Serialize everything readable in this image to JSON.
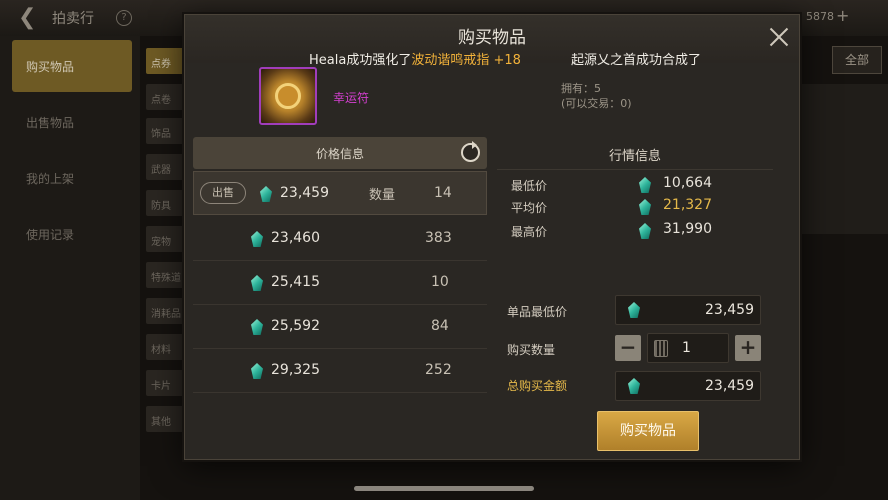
{
  "background": {
    "back_icon": "back-arrow-icon",
    "title": "拍卖行",
    "currency": "5878",
    "sidebar_items": [
      "购买物品",
      "出售物品",
      "我的上架",
      "使用记录"
    ],
    "categories": [
      "点券",
      "点卷",
      "饰品",
      "武器",
      "防具",
      "宠物",
      "特殊道",
      "消耗品",
      "材料",
      "卡片",
      "其他"
    ],
    "right_button": "全部"
  },
  "modal": {
    "title": "购买物品",
    "ticker": {
      "prefix": "Heala成功强化了",
      "item": "波动谐鸣戒指 +18",
      "second": "起源乂之首成功合成了"
    },
    "item": {
      "name": "幸运符",
      "owned": "拥有：5",
      "tradable": "(可以交易：0)",
      "rarity_color": "#a03dbb"
    },
    "price_info": {
      "header": "价格信息",
      "sell_tag": "出售",
      "qty_header": "数量",
      "rows": [
        {
          "price": "23,459",
          "qty": "14"
        },
        {
          "price": "23,460",
          "qty": "383"
        },
        {
          "price": "25,415",
          "qty": "10"
        },
        {
          "price": "25,592",
          "qty": "84"
        },
        {
          "price": "29,325",
          "qty": "252"
        }
      ]
    },
    "market_info": {
      "title": "行情信息",
      "rows": [
        {
          "label": "最低价",
          "value": "10,664"
        },
        {
          "label": "平均价",
          "value": "21,327"
        },
        {
          "label": "最高价",
          "value": "31,990"
        }
      ]
    },
    "form": {
      "unit_price_label": "单品最低价",
      "unit_price": "23,459",
      "qty_label": "购买数量",
      "qty": "1",
      "total_label": "总购买金额",
      "total": "23,459"
    },
    "buy_button": "购买物品"
  },
  "colors": {
    "accent_gold": "#e5b94a",
    "rare_purple": "#d43fd0",
    "gem_teal": "#2fb59c"
  }
}
